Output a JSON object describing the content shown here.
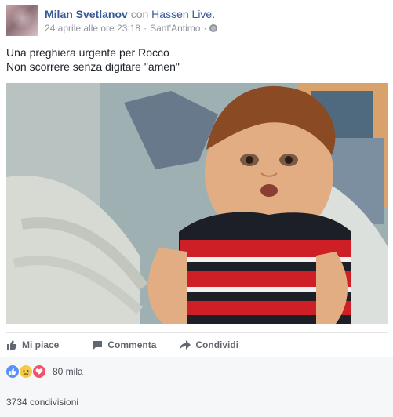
{
  "post": {
    "author": "Milan Svetlanov",
    "with_text": "con",
    "tagged": "Hassen Live.",
    "timestamp": "24 aprile alle ore 23:18",
    "separator": "·",
    "location": "Sant'Antimo",
    "separator2": "·",
    "privacy_icon": "globe-icon",
    "text_lines": [
      "Una preghiera urgente per Rocco",
      "Non scorrere senza digitare \"amen\""
    ]
  },
  "actions": {
    "like": "Mi piace",
    "comment": "Commenta",
    "share": "Condividi"
  },
  "reactions": {
    "icons": [
      "like-reaction-icon",
      "sad-reaction-icon",
      "love-reaction-icon"
    ],
    "count": "80 mila",
    "shares": "3734 condivisioni"
  },
  "colors": {
    "link": "#365899",
    "meta": "#90949c",
    "text": "#1d2129",
    "action": "#616770",
    "like": "#5890ff",
    "sad": "#f7c94a",
    "love": "#f25268"
  }
}
